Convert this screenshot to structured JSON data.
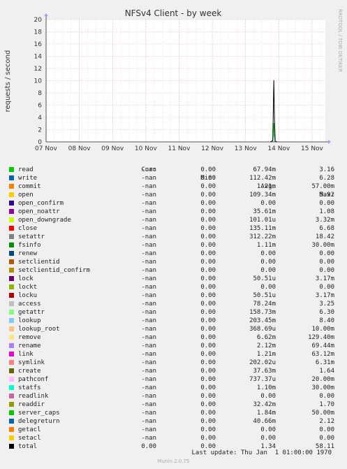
{
  "chart_data": {
    "type": "line",
    "title": "NFSv4 Client - by week",
    "ylabel": "requests / second",
    "side_text": "RRDTOOL / TOBI OETIKER",
    "ylim": [
      0,
      20
    ],
    "y_ticks": [
      0,
      2,
      4,
      6,
      8,
      10,
      12,
      14,
      16,
      18,
      20
    ],
    "x_tick_labels": [
      "07 Nov",
      "08 Nov",
      "09 Nov",
      "10 Nov",
      "11 Nov",
      "12 Nov",
      "13 Nov",
      "14 Nov",
      "15 Nov"
    ],
    "x_range_days": [
      0,
      8.4
    ],
    "grid": true,
    "spike": {
      "day": 6.85,
      "series": [
        {
          "name": "total",
          "peak": 10.1
        },
        {
          "name": "read",
          "peak": 3.1
        },
        {
          "name": "getattr",
          "peak": 2.5
        },
        {
          "name": "lookup",
          "peak": 1.4
        }
      ]
    },
    "columns": [
      "Cur:",
      "Min:",
      "Avg:",
      "Max:"
    ],
    "series": [
      {
        "name": "read",
        "color": "#00cc00",
        "cur": "-nan",
        "min": "0.00",
        "avg": "67.94m",
        "max": "3.16"
      },
      {
        "name": "write",
        "color": "#0066b3",
        "cur": "-nan",
        "min": "0.00",
        "avg": "112.42m",
        "max": "6.28"
      },
      {
        "name": "commit",
        "color": "#ff8000",
        "cur": "-nan",
        "min": "0.00",
        "avg": "1.21m",
        "max": "57.00m"
      },
      {
        "name": "open",
        "color": "#ffcc00",
        "cur": "-nan",
        "min": "0.00",
        "avg": "109.34m",
        "max": "5.92"
      },
      {
        "name": "open_confirm",
        "color": "#330099",
        "cur": "-nan",
        "min": "0.00",
        "avg": "0.00",
        "max": "0.00"
      },
      {
        "name": "open_noattr",
        "color": "#990099",
        "cur": "-nan",
        "min": "0.00",
        "avg": "35.61m",
        "max": "1.08"
      },
      {
        "name": "open_downgrade",
        "color": "#ccff00",
        "cur": "-nan",
        "min": "0.00",
        "avg": "101.01u",
        "max": "3.32m"
      },
      {
        "name": "close",
        "color": "#ff0000",
        "cur": "-nan",
        "min": "0.00",
        "avg": "135.11m",
        "max": "6.68"
      },
      {
        "name": "setattr",
        "color": "#808080",
        "cur": "-nan",
        "min": "0.00",
        "avg": "312.22m",
        "max": "18.42"
      },
      {
        "name": "fsinfo",
        "color": "#008f00",
        "cur": "-nan",
        "min": "0.00",
        "avg": "1.11m",
        "max": "30.00m"
      },
      {
        "name": "renew",
        "color": "#00487d",
        "cur": "-nan",
        "min": "0.00",
        "avg": "0.00",
        "max": "0.00"
      },
      {
        "name": "setclientid",
        "color": "#b35a00",
        "cur": "-nan",
        "min": "0.00",
        "avg": "0.00",
        "max": "0.00"
      },
      {
        "name": "setclientid_confirm",
        "color": "#b38f00",
        "cur": "-nan",
        "min": "0.00",
        "avg": "0.00",
        "max": "0.00"
      },
      {
        "name": "lock",
        "color": "#6b006b",
        "cur": "-nan",
        "min": "0.00",
        "avg": "50.51u",
        "max": "3.17m"
      },
      {
        "name": "lockt",
        "color": "#8fb300",
        "cur": "-nan",
        "min": "0.00",
        "avg": "0.00",
        "max": "0.00"
      },
      {
        "name": "locku",
        "color": "#b30000",
        "cur": "-nan",
        "min": "0.00",
        "avg": "50.51u",
        "max": "3.17m"
      },
      {
        "name": "access",
        "color": "#bebebe",
        "cur": "-nan",
        "min": "0.00",
        "avg": "78.24m",
        "max": "3.25"
      },
      {
        "name": "getattr",
        "color": "#80ff80",
        "cur": "-nan",
        "min": "0.00",
        "avg": "158.73m",
        "max": "6.30"
      },
      {
        "name": "lookup",
        "color": "#80c9ff",
        "cur": "-nan",
        "min": "0.00",
        "avg": "203.45m",
        "max": "8.40"
      },
      {
        "name": "lookup_root",
        "color": "#ffc080",
        "cur": "-nan",
        "min": "0.00",
        "avg": "368.69u",
        "max": "10.00m"
      },
      {
        "name": "remove",
        "color": "#ffe680",
        "cur": "-nan",
        "min": "0.00",
        "avg": "6.62m",
        "max": "129.40m"
      },
      {
        "name": "rename",
        "color": "#aa80ff",
        "cur": "-nan",
        "min": "0.00",
        "avg": "2.12m",
        "max": "69.44m"
      },
      {
        "name": "link",
        "color": "#ee00cc",
        "cur": "-nan",
        "min": "0.00",
        "avg": "1.21m",
        "max": "63.12m"
      },
      {
        "name": "symlink",
        "color": "#ff8080",
        "cur": "-nan",
        "min": "0.00",
        "avg": "202.02u",
        "max": "6.31m"
      },
      {
        "name": "create",
        "color": "#666600",
        "cur": "-nan",
        "min": "0.00",
        "avg": "37.63m",
        "max": "1.64"
      },
      {
        "name": "pathconf",
        "color": "#ffbfff",
        "cur": "-nan",
        "min": "0.00",
        "avg": "737.37u",
        "max": "20.00m"
      },
      {
        "name": "statfs",
        "color": "#00ffcc",
        "cur": "-nan",
        "min": "0.00",
        "avg": "1.10m",
        "max": "30.00m"
      },
      {
        "name": "readlink",
        "color": "#cc6699",
        "cur": "-nan",
        "min": "0.00",
        "avg": "0.00",
        "max": "0.00"
      },
      {
        "name": "readdir",
        "color": "#999900",
        "cur": "-nan",
        "min": "0.00",
        "avg": "32.42m",
        "max": "1.70"
      },
      {
        "name": "server_caps",
        "color": "#00cc00",
        "cur": "-nan",
        "min": "0.00",
        "avg": "1.84m",
        "max": "50.00m"
      },
      {
        "name": "delegreturn",
        "color": "#0066b3",
        "cur": "-nan",
        "min": "0.00",
        "avg": "40.66m",
        "max": "2.12"
      },
      {
        "name": "getacl",
        "color": "#ff8000",
        "cur": "-nan",
        "min": "0.00",
        "avg": "0.00",
        "max": "0.00"
      },
      {
        "name": "setacl",
        "color": "#ffcc00",
        "cur": "-nan",
        "min": "0.00",
        "avg": "0.00",
        "max": "0.00"
      },
      {
        "name": "total",
        "color": "#000000",
        "cur": "0.00",
        "min": "0.00",
        "avg": "1.34",
        "max": "58.11"
      }
    ]
  },
  "footer": {
    "last_update": "Last update: Thu Jan  1 01:00:00 1970",
    "version": "Munin 2.0.75"
  }
}
